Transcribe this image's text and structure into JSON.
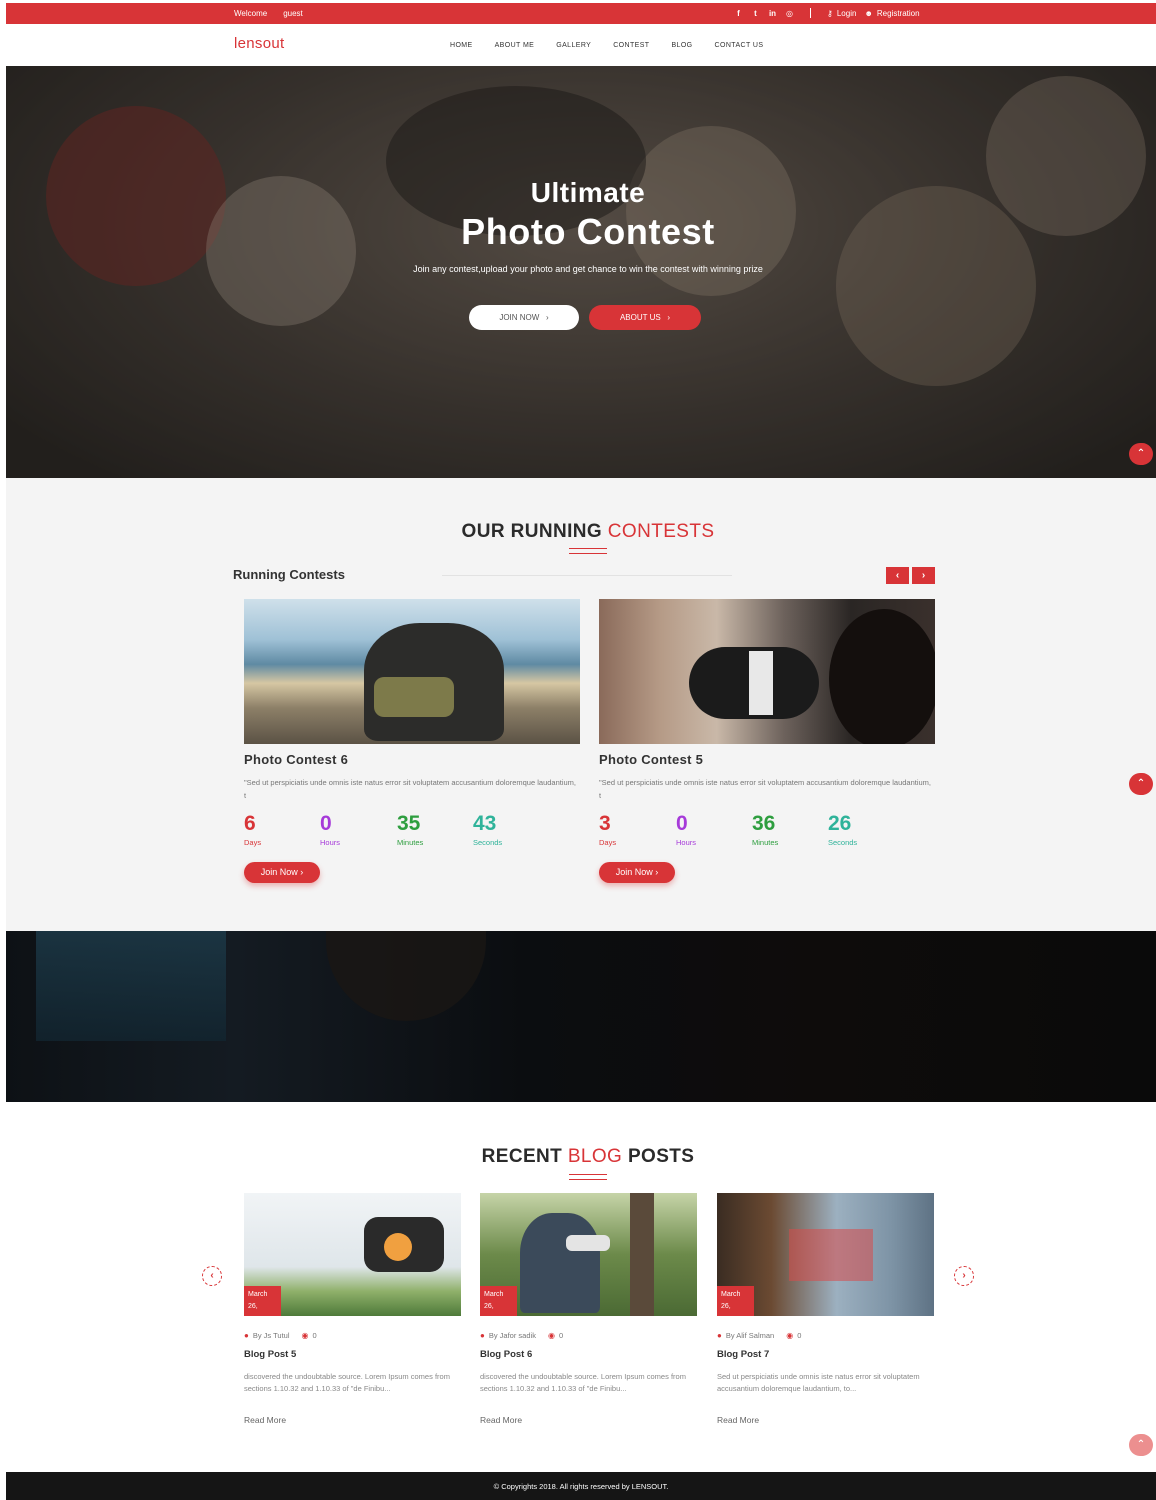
{
  "topbar": {
    "welcome": "Welcome",
    "user": "guest",
    "social_icons": [
      "facebook-icon",
      "twitter-icon",
      "linkedin-icon",
      "instagram-icon"
    ],
    "login_label": "Login",
    "registration_label": "Registration"
  },
  "brand": {
    "logo": "lensout",
    "accent_color": "#d83437"
  },
  "nav": {
    "items": [
      "HOME",
      "ABOUT ME",
      "GALLERY",
      "CONTEST",
      "BLOG",
      "CONTACT US"
    ]
  },
  "hero": {
    "title_line1": "Ultimate",
    "title_line2": "Photo Contest",
    "subtitle": "Join any contest,upload your photo and get chance to win the contest with winning prize",
    "join_button": "JOIN NOW",
    "about_button": "ABOUT US"
  },
  "contests": {
    "title_part1": "OUR RUNNING",
    "title_part2": "CONTESTS",
    "running_label": "Running Contests",
    "cards": [
      {
        "title": "Photo Contest 6",
        "desc": "\"Sed ut perspiciatis unde omnis iste natus error sit voluptatem accusantium doloremque laudantium, t",
        "countdown": [
          {
            "value": "6",
            "label": "Days",
            "color": "#d83437"
          },
          {
            "value": "0",
            "label": "Hours",
            "color": "#a63ad9"
          },
          {
            "value": "35",
            "label": "Minutes",
            "color": "#2e9e3f"
          },
          {
            "value": "43",
            "label": "Seconds",
            "color": "#2fb39a"
          }
        ],
        "button": "Join Now"
      },
      {
        "title": "Photo Contest 5",
        "desc": "\"Sed ut perspiciatis unde omnis iste natus error sit voluptatem accusantium doloremque laudantium, t",
        "countdown": [
          {
            "value": "3",
            "label": "Days",
            "color": "#d83437"
          },
          {
            "value": "0",
            "label": "Hours",
            "color": "#a63ad9"
          },
          {
            "value": "36",
            "label": "Minutes",
            "color": "#2e9e3f"
          },
          {
            "value": "26",
            "label": "Seconds",
            "color": "#2fb39a"
          }
        ],
        "button": "Join Now"
      }
    ]
  },
  "blog": {
    "title_part1": "RECENT",
    "title_part2": "BLOG",
    "title_part3": "POSTS",
    "posts": [
      {
        "month": "March",
        "day": "26,",
        "author": "By Js Tutul",
        "views": "0",
        "title": "Blog Post 5",
        "desc": "discovered the undoubtable source. Lorem Ipsum comes from sections 1.10.32 and 1.10.33 of \"de Finibu...",
        "read_more": "Read More"
      },
      {
        "month": "March",
        "day": "26,",
        "author": "By Jafor sadik",
        "views": "0",
        "title": "Blog Post 6",
        "desc": "discovered the undoubtable source. Lorem Ipsum comes from sections 1.10.32 and 1.10.33 of \"de Finibu...",
        "read_more": "Read More"
      },
      {
        "month": "March",
        "day": "26,",
        "author": "By Alif Salman",
        "views": "0",
        "title": "Blog Post 7",
        "desc": "Sed ut perspiciatis unde omnis iste natus error sit voluptatem accusantium doloremque laudantium, to...",
        "read_more": "Read More"
      }
    ]
  },
  "footer": {
    "text": "© Copyrights 2018. All rights reserved by LENSOUT."
  }
}
